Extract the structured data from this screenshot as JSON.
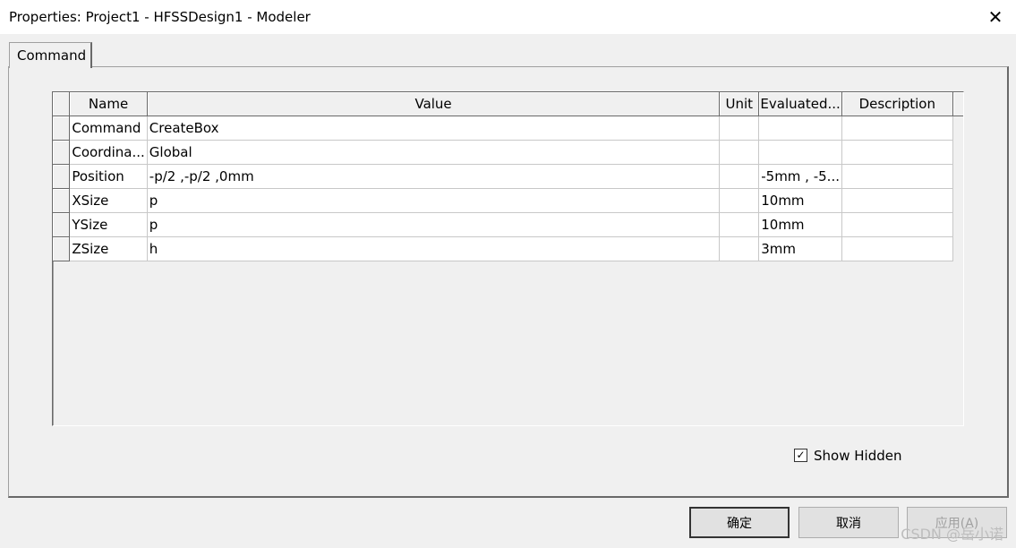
{
  "window": {
    "title": "Properties: Project1 - HFSSDesign1 - Modeler",
    "close_glyph": "✕"
  },
  "tab": {
    "label": "Command"
  },
  "table": {
    "columns": [
      "Name",
      "Value",
      "Unit",
      "Evaluated...",
      "Description"
    ],
    "rows": [
      {
        "name": "Command",
        "value": "CreateBox",
        "unit": "",
        "evaluated": "",
        "description": ""
      },
      {
        "name": "Coordina...",
        "value": "Global",
        "unit": "",
        "evaluated": "",
        "description": ""
      },
      {
        "name": "Position",
        "value": "-p/2 ,-p/2 ,0mm",
        "unit": "",
        "evaluated": "-5mm , -5...",
        "description": ""
      },
      {
        "name": "XSize",
        "value": "p",
        "unit": "",
        "evaluated": "10mm",
        "description": ""
      },
      {
        "name": "YSize",
        "value": "p",
        "unit": "",
        "evaluated": "10mm",
        "description": ""
      },
      {
        "name": "ZSize",
        "value": "h",
        "unit": "",
        "evaluated": "3mm",
        "description": ""
      }
    ]
  },
  "show_hidden": {
    "label": "Show Hidden",
    "checked": true,
    "glyph": "✓"
  },
  "buttons": {
    "ok": "确定",
    "cancel": "取消",
    "apply": "应用(A)"
  },
  "watermark": "CSDN @岳小诺"
}
